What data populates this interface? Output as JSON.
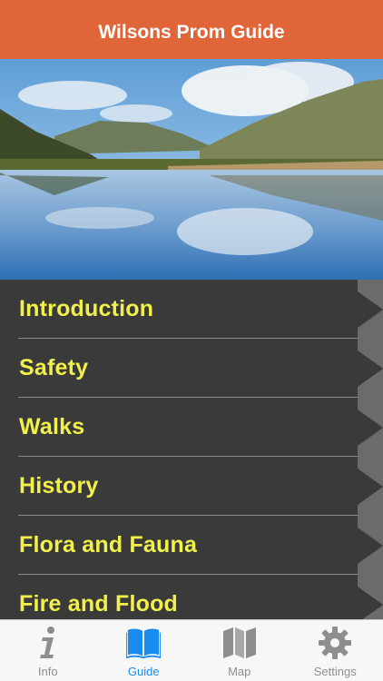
{
  "navbar": {
    "title": "Wilsons Prom Guide"
  },
  "hero": {
    "image": "landscape-photo"
  },
  "menu": {
    "items": [
      {
        "label": "Introduction"
      },
      {
        "label": "Safety"
      },
      {
        "label": "Walks"
      },
      {
        "label": "History"
      },
      {
        "label": "Flora and Fauna"
      },
      {
        "label": "Fire and Flood"
      }
    ]
  },
  "tabbar": {
    "tabs": [
      {
        "label": "Info",
        "icon": "info-icon"
      },
      {
        "label": "Guide",
        "icon": "book-icon"
      },
      {
        "label": "Map",
        "icon": "map-icon"
      },
      {
        "label": "Settings",
        "icon": "gear-icon"
      }
    ],
    "active": "Guide"
  },
  "colors": {
    "navbar": "#e0663a",
    "menu_bg": "#3a3a3a",
    "menu_text": "#f2f04a",
    "tab_active": "#1a8cf0",
    "tab_inactive": "#8e8e8e"
  }
}
